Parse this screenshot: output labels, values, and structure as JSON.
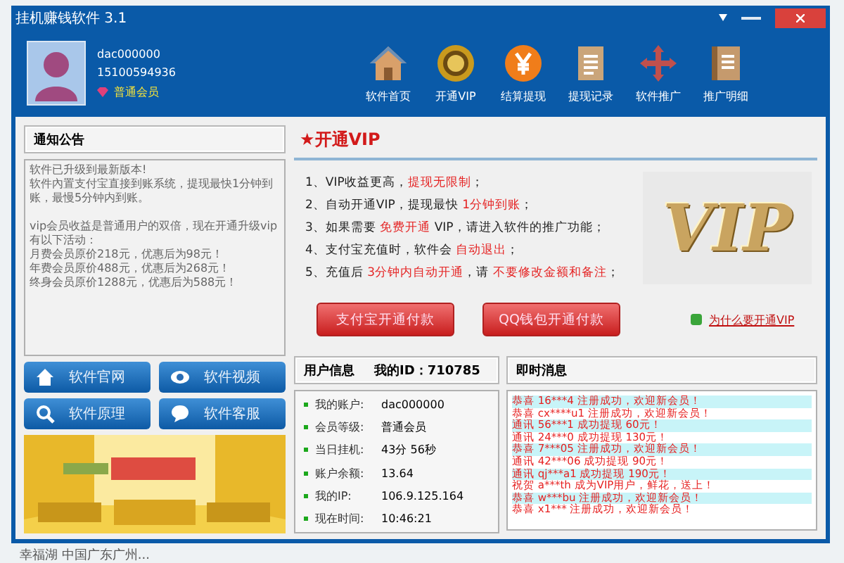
{
  "window": {
    "title": "挂机赚钱软件 3.1"
  },
  "profile": {
    "account": "dac000000",
    "phone": "15100594936",
    "level": "普通会员"
  },
  "toolbar": [
    "软件首页",
    "开通VIP",
    "结算提现",
    "提现记录",
    "软件推广",
    "推广明细"
  ],
  "notice": {
    "title": "通知公告",
    "paragraphs": [
      [
        "软件已升级到最新版本!",
        "软件內置支付宝直接到账系统，提现最快1分钟到账，最慢5分钟内到账。"
      ],
      [
        "vip会员收益是普通用户的双倍，现在开通升级vip有以下活动：",
        "月费会员原价218元，优惠后为98元！",
        "年费会员原价488元，优惠后为268元！",
        "终身会员原价1288元，优惠后为588元！"
      ]
    ]
  },
  "links": [
    "软件官网",
    "软件视频",
    "软件原理",
    "软件客服"
  ],
  "vip": {
    "title": "★开通VIP",
    "badge": "VIP",
    "items": [
      [
        {
          "text": "1、VIP收益更高，",
          "highlight": false
        },
        {
          "text": "提现无限制",
          "highlight": true
        },
        {
          "text": "；",
          "highlight": false
        }
      ],
      [
        {
          "text": "2、自动开通VIP，提现最快 ",
          "highlight": false
        },
        {
          "text": "1分钟到账",
          "highlight": true
        },
        {
          "text": "；",
          "highlight": false
        }
      ],
      [
        {
          "text": "3、如果需要 ",
          "highlight": false
        },
        {
          "text": "免费开通",
          "highlight": true
        },
        {
          "text": " VIP，请进入软件的推广功能；",
          "highlight": false
        }
      ],
      [
        {
          "text": "4、支付宝充值时，软件会 ",
          "highlight": false
        },
        {
          "text": "自动退出",
          "highlight": true
        },
        {
          "text": "；",
          "highlight": false
        }
      ],
      [
        {
          "text": "5、充值后 ",
          "highlight": false
        },
        {
          "text": "3分钟内自动开通",
          "highlight": true
        },
        {
          "text": "，请 ",
          "highlight": false
        },
        {
          "text": "不要修改金额和备注",
          "highlight": true
        },
        {
          "text": "；",
          "highlight": false
        }
      ]
    ],
    "buttons": [
      "支付宝开通付款",
      "QQ钱包开通付款"
    ],
    "help_link": "为什么要开通VIP"
  },
  "user_info": {
    "title": "用户信息",
    "id_label": "我的ID：710785",
    "rows": [
      {
        "label": "我的账户:",
        "value": "dac000000"
      },
      {
        "label": "会员等级:",
        "value": "普通会员"
      },
      {
        "label": "当日挂机:",
        "value": "43分 56秒"
      },
      {
        "label": "账户余额:",
        "value": "13.64"
      },
      {
        "label": "我的IP:",
        "value": "106.9.125.164"
      },
      {
        "label": "现在时间:",
        "value": "10:46:21"
      }
    ]
  },
  "messages": {
    "title": "即时消息",
    "items": [
      "恭喜 16***4 注册成功，欢迎新会员！",
      "恭喜 cx****u1 注册成功，欢迎新会员！",
      "通讯 56***1 成功提现 60元！",
      "通讯 24***0 成功提现 130元！",
      "恭喜 7***05 注册成功，欢迎新会员！",
      "通讯 42***06 成功提现 90元！",
      "通讯 qj***a1 成功提现 190元！",
      "祝贺 a***th 成为VIP用户，鲜花，送上！",
      "恭喜 w***bu 注册成功，欢迎新会员！",
      "恭喜 x1*** 注册成功，欢迎新会员！"
    ]
  },
  "background_text": "幸福湖 中国广东广州..."
}
